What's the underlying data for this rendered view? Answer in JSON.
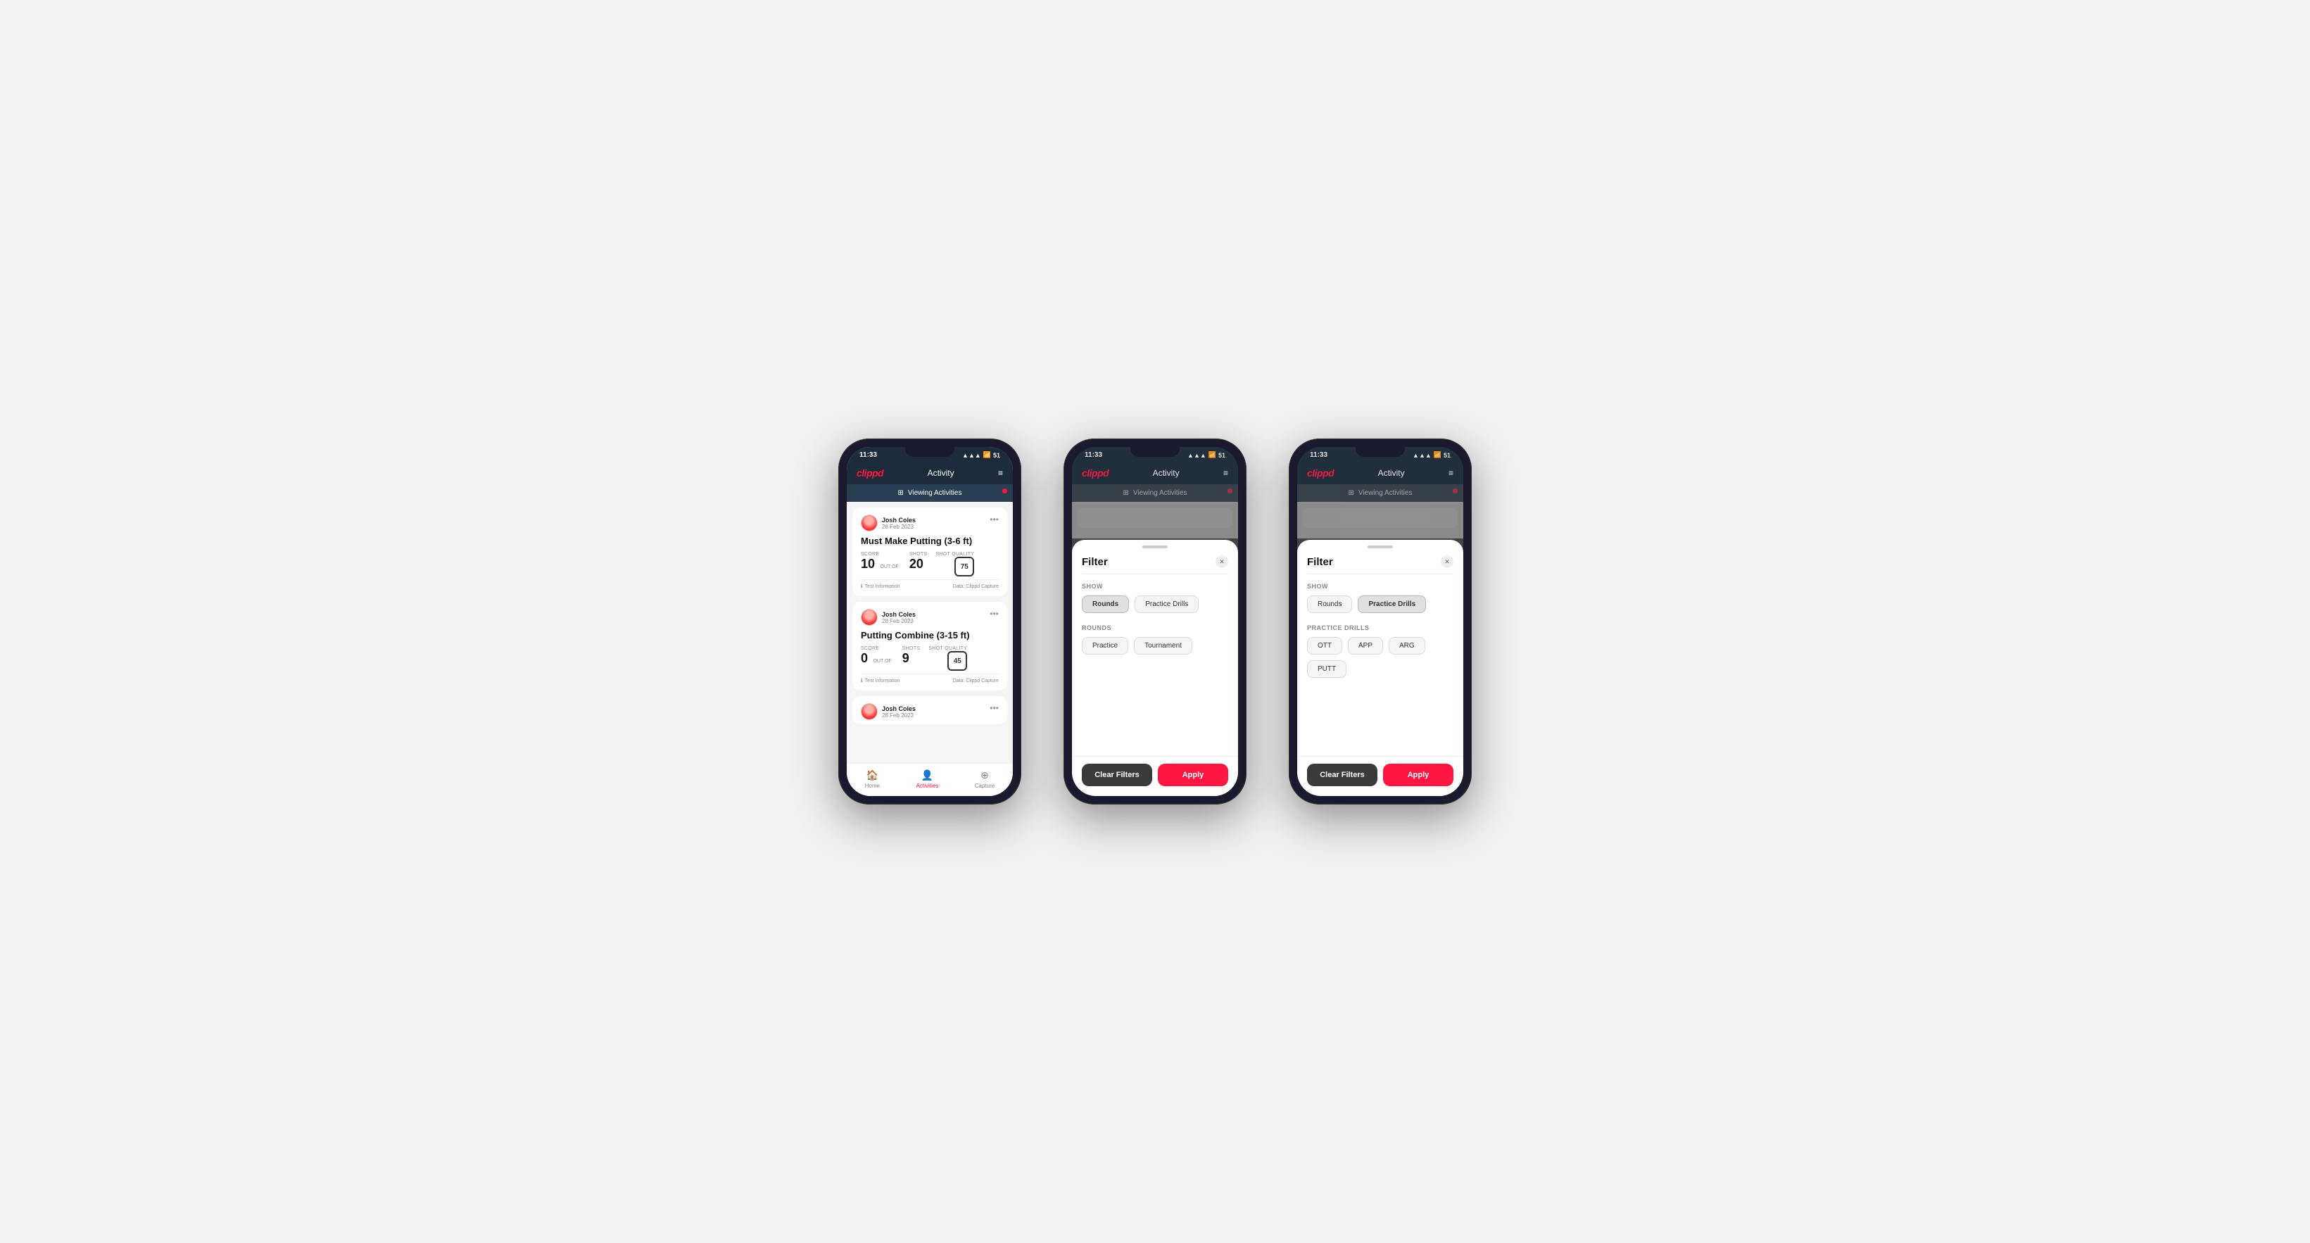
{
  "phones": {
    "phone1": {
      "status": {
        "time": "11:33",
        "signal": "▲▲▲",
        "wifi": "WiFi",
        "battery": "51"
      },
      "header": {
        "logo": "clippd",
        "title": "Activity",
        "menu": "≡"
      },
      "banner": {
        "text": "Viewing Activities",
        "icon": "⊞"
      },
      "cards": [
        {
          "user": "Josh Coles",
          "date": "28 Feb 2023",
          "title": "Must Make Putting (3-6 ft)",
          "score_label": "Score",
          "score": "10",
          "out_of_label": "OUT OF",
          "shots_label": "Shots",
          "shots": "20",
          "shot_quality_label": "Shot Quality",
          "shot_quality": "75",
          "info": "Test Information",
          "data": "Data: Clippd Capture"
        },
        {
          "user": "Josh Coles",
          "date": "28 Feb 2023",
          "title": "Putting Combine (3-15 ft)",
          "score_label": "Score",
          "score": "0",
          "out_of_label": "OUT OF",
          "shots_label": "Shots",
          "shots": "9",
          "shot_quality_label": "Shot Quality",
          "shot_quality": "45",
          "info": "Test Information",
          "data": "Data: Clippd Capture"
        },
        {
          "user": "Josh Coles",
          "date": "28 Feb 2023",
          "title": "",
          "score_label": "",
          "score": "",
          "shots": "",
          "shot_quality": "",
          "info": "",
          "data": ""
        }
      ],
      "nav": [
        {
          "label": "Home",
          "icon": "🏠",
          "active": false
        },
        {
          "label": "Activities",
          "icon": "👤",
          "active": true
        },
        {
          "label": "Capture",
          "icon": "⊕",
          "active": false
        }
      ]
    },
    "phone2": {
      "status": {
        "time": "11:33"
      },
      "header": {
        "logo": "clippd",
        "title": "Activity"
      },
      "banner": {
        "text": "Viewing Activities"
      },
      "filter": {
        "title": "Filter",
        "show_label": "Show",
        "show_buttons": [
          {
            "label": "Rounds",
            "active": true
          },
          {
            "label": "Practice Drills",
            "active": false
          }
        ],
        "rounds_label": "Rounds",
        "rounds_buttons": [
          {
            "label": "Practice",
            "active": false
          },
          {
            "label": "Tournament",
            "active": false
          }
        ],
        "clear_label": "Clear Filters",
        "apply_label": "Apply"
      }
    },
    "phone3": {
      "status": {
        "time": "11:33"
      },
      "header": {
        "logo": "clippd",
        "title": "Activity"
      },
      "banner": {
        "text": "Viewing Activities"
      },
      "filter": {
        "title": "Filter",
        "show_label": "Show",
        "show_buttons": [
          {
            "label": "Rounds",
            "active": false
          },
          {
            "label": "Practice Drills",
            "active": true
          }
        ],
        "practice_drills_label": "Practice Drills",
        "drill_buttons": [
          {
            "label": "OTT",
            "active": false
          },
          {
            "label": "APP",
            "active": false
          },
          {
            "label": "ARG",
            "active": false
          },
          {
            "label": "PUTT",
            "active": false
          }
        ],
        "clear_label": "Clear Filters",
        "apply_label": "Apply"
      }
    }
  }
}
